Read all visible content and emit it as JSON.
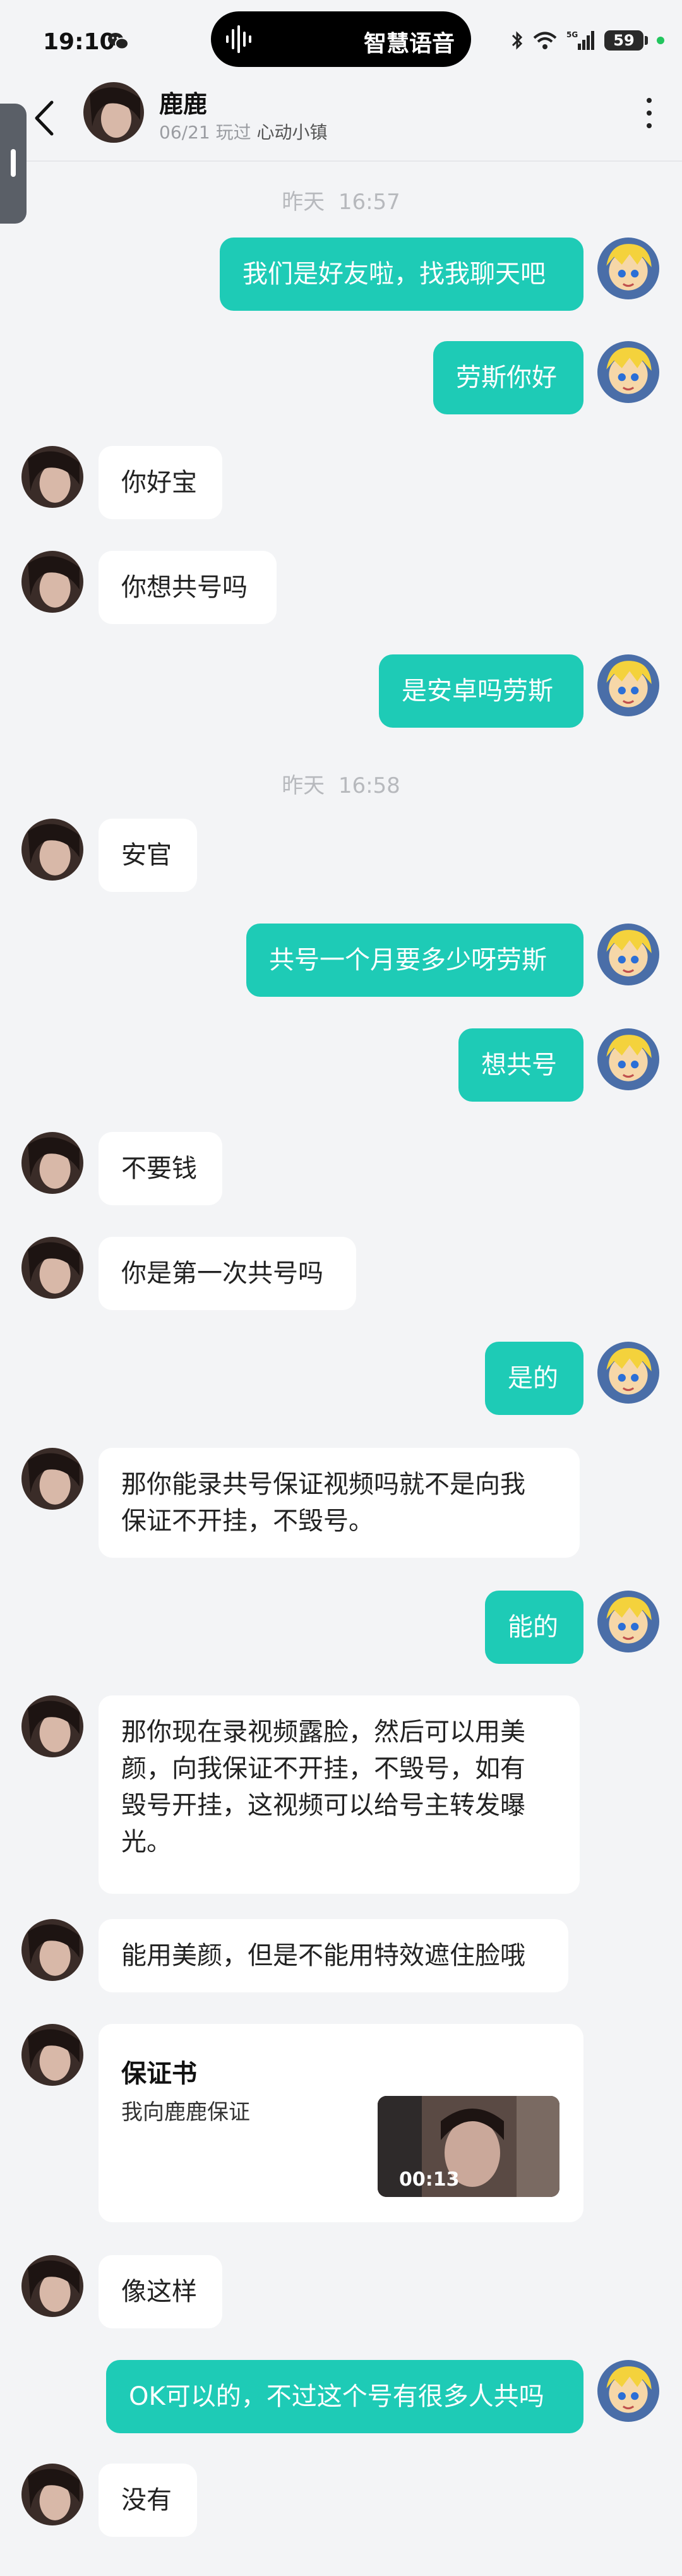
{
  "status_bar": {
    "time": "19:10",
    "pill_text": "智慧语音",
    "battery": "59",
    "icons": [
      "wechat-icon",
      "voice-wave-icon",
      "bluetooth-icon",
      "wifi-icon",
      "5g-signal-icon",
      "battery-icon"
    ]
  },
  "header": {
    "name": "鹿鹿",
    "date": "06/21",
    "played_prefix": "玩过",
    "game": "心动小镇"
  },
  "timestamps": [
    {
      "label": "昨天",
      "time": "16:57"
    },
    {
      "label": "昨天",
      "time": "16:58"
    }
  ],
  "messages": [
    {
      "side": "out",
      "text": "我们是好友啦，找我聊天吧"
    },
    {
      "side": "out",
      "text": "劳斯你好"
    },
    {
      "side": "in",
      "text": "你好宝"
    },
    {
      "side": "in",
      "text": "你想共号吗"
    },
    {
      "side": "out",
      "text": "是安卓吗劳斯"
    },
    {
      "side": "in",
      "text": "安官"
    },
    {
      "side": "out",
      "text": "共号一个月要多少呀劳斯"
    },
    {
      "side": "out",
      "text": "想共号"
    },
    {
      "side": "in",
      "text": "不要钱"
    },
    {
      "side": "in",
      "text": "你是第一次共号吗"
    },
    {
      "side": "out",
      "text": "是的"
    },
    {
      "side": "in",
      "text": "那你能录共号保证视频吗就不是向我\n保证不开挂，不毁号。"
    },
    {
      "side": "out",
      "text": "能的"
    },
    {
      "side": "in",
      "text": "那你现在录视频露脸，然后可以用美\n颜，向我保证不开挂，不毁号，如有\n毁号开挂，这视频可以给号主转发曝\n光。"
    },
    {
      "side": "in",
      "text": "能用美颜，但是不能用特效遮住脸哦"
    },
    {
      "side": "in",
      "text": "像这样"
    },
    {
      "side": "out",
      "text": "OK可以的，不过这个号有很多人共吗"
    },
    {
      "side": "in",
      "text": "没有"
    }
  ],
  "card": {
    "title": "保证书",
    "body": "我向鹿鹿保证",
    "video_duration": "00:13"
  },
  "colors": {
    "background": "#f3f4f6",
    "outgoing_bubble": "#1ecbb6",
    "incoming_bubble": "#ffffff"
  }
}
